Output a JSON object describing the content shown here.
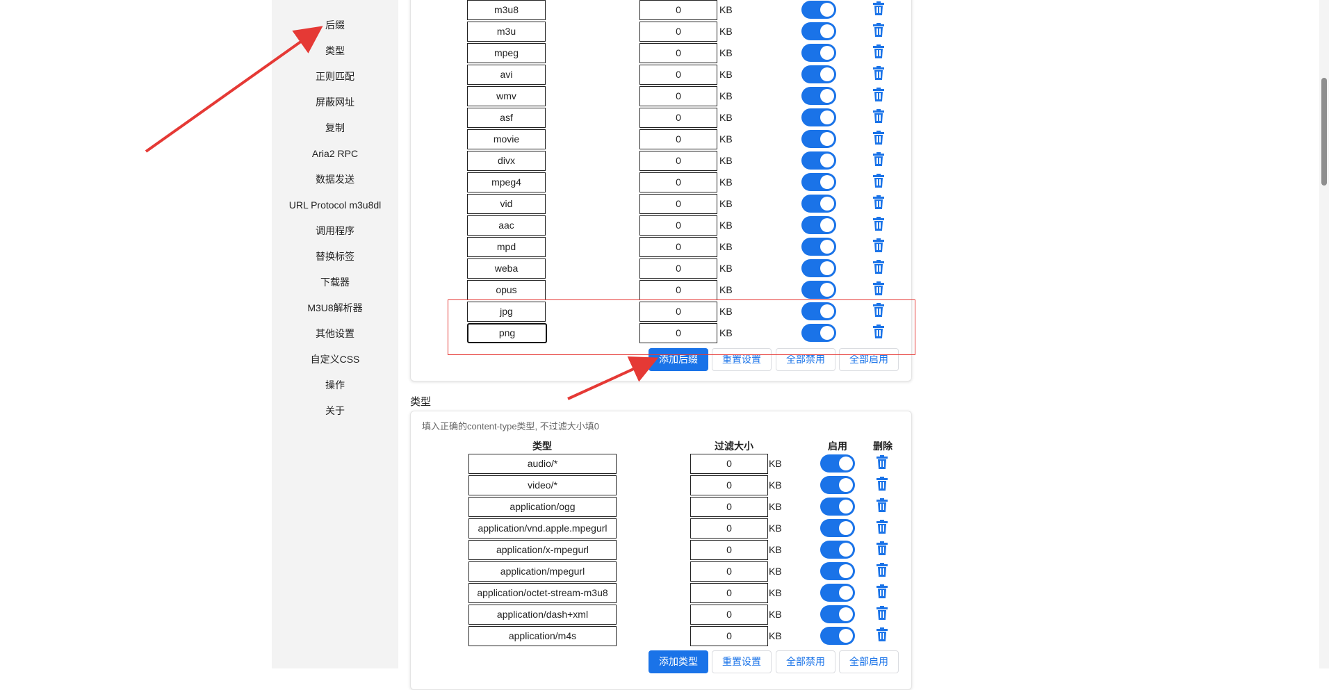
{
  "sidebar": {
    "items": [
      "后缀",
      "类型",
      "正则匹配",
      "屏蔽网址",
      "复制",
      "Aria2 RPC",
      "数据发送",
      "URL Protocol m3u8dl",
      "调用程序",
      "替换标签",
      "下载器",
      "M3U8解析器",
      "其他设置",
      "自定义CSS",
      "操作",
      "关于"
    ]
  },
  "suffix": {
    "rows": [
      {
        "name": "m3u8",
        "size": "0",
        "unit": "KB",
        "enabled": true
      },
      {
        "name": "m3u",
        "size": "0",
        "unit": "KB",
        "enabled": true
      },
      {
        "name": "mpeg",
        "size": "0",
        "unit": "KB",
        "enabled": true
      },
      {
        "name": "avi",
        "size": "0",
        "unit": "KB",
        "enabled": true
      },
      {
        "name": "wmv",
        "size": "0",
        "unit": "KB",
        "enabled": true
      },
      {
        "name": "asf",
        "size": "0",
        "unit": "KB",
        "enabled": true
      },
      {
        "name": "movie",
        "size": "0",
        "unit": "KB",
        "enabled": true
      },
      {
        "name": "divx",
        "size": "0",
        "unit": "KB",
        "enabled": true
      },
      {
        "name": "mpeg4",
        "size": "0",
        "unit": "KB",
        "enabled": true
      },
      {
        "name": "vid",
        "size": "0",
        "unit": "KB",
        "enabled": true
      },
      {
        "name": "aac",
        "size": "0",
        "unit": "KB",
        "enabled": true
      },
      {
        "name": "mpd",
        "size": "0",
        "unit": "KB",
        "enabled": true
      },
      {
        "name": "weba",
        "size": "0",
        "unit": "KB",
        "enabled": true
      },
      {
        "name": "opus",
        "size": "0",
        "unit": "KB",
        "enabled": true
      },
      {
        "name": "jpg",
        "size": "0",
        "unit": "KB",
        "enabled": true
      },
      {
        "name": "png",
        "size": "0",
        "unit": "KB",
        "enabled": true
      }
    ],
    "buttons": {
      "add": "添加后缀",
      "reset": "重置设置",
      "disable_all": "全部禁用",
      "enable_all": "全部启用"
    }
  },
  "type": {
    "title": "类型",
    "hint": "填入正确的content-type类型, 不过滤大小填0",
    "headers": {
      "type": "类型",
      "size": "过滤大小",
      "enable": "启用",
      "delete": "删除"
    },
    "rows": [
      {
        "name": "audio/*",
        "size": "0",
        "unit": "KB",
        "enabled": true
      },
      {
        "name": "video/*",
        "size": "0",
        "unit": "KB",
        "enabled": true
      },
      {
        "name": "application/ogg",
        "size": "0",
        "unit": "KB",
        "enabled": true
      },
      {
        "name": "application/vnd.apple.mpegurl",
        "size": "0",
        "unit": "KB",
        "enabled": true
      },
      {
        "name": "application/x-mpegurl",
        "size": "0",
        "unit": "KB",
        "enabled": true
      },
      {
        "name": "application/mpegurl",
        "size": "0",
        "unit": "KB",
        "enabled": true
      },
      {
        "name": "application/octet-stream-m3u8",
        "size": "0",
        "unit": "KB",
        "enabled": true
      },
      {
        "name": "application/dash+xml",
        "size": "0",
        "unit": "KB",
        "enabled": true
      },
      {
        "name": "application/m4s",
        "size": "0",
        "unit": "KB",
        "enabled": true
      }
    ],
    "buttons": {
      "add": "添加类型",
      "reset": "重置设置",
      "disable_all": "全部禁用",
      "enable_all": "全部启用"
    }
  },
  "colors": {
    "accent": "#1a73e8",
    "annotation": "#e53935"
  },
  "icons": {
    "delete": "trash-icon",
    "toggle": "toggle-switch"
  }
}
